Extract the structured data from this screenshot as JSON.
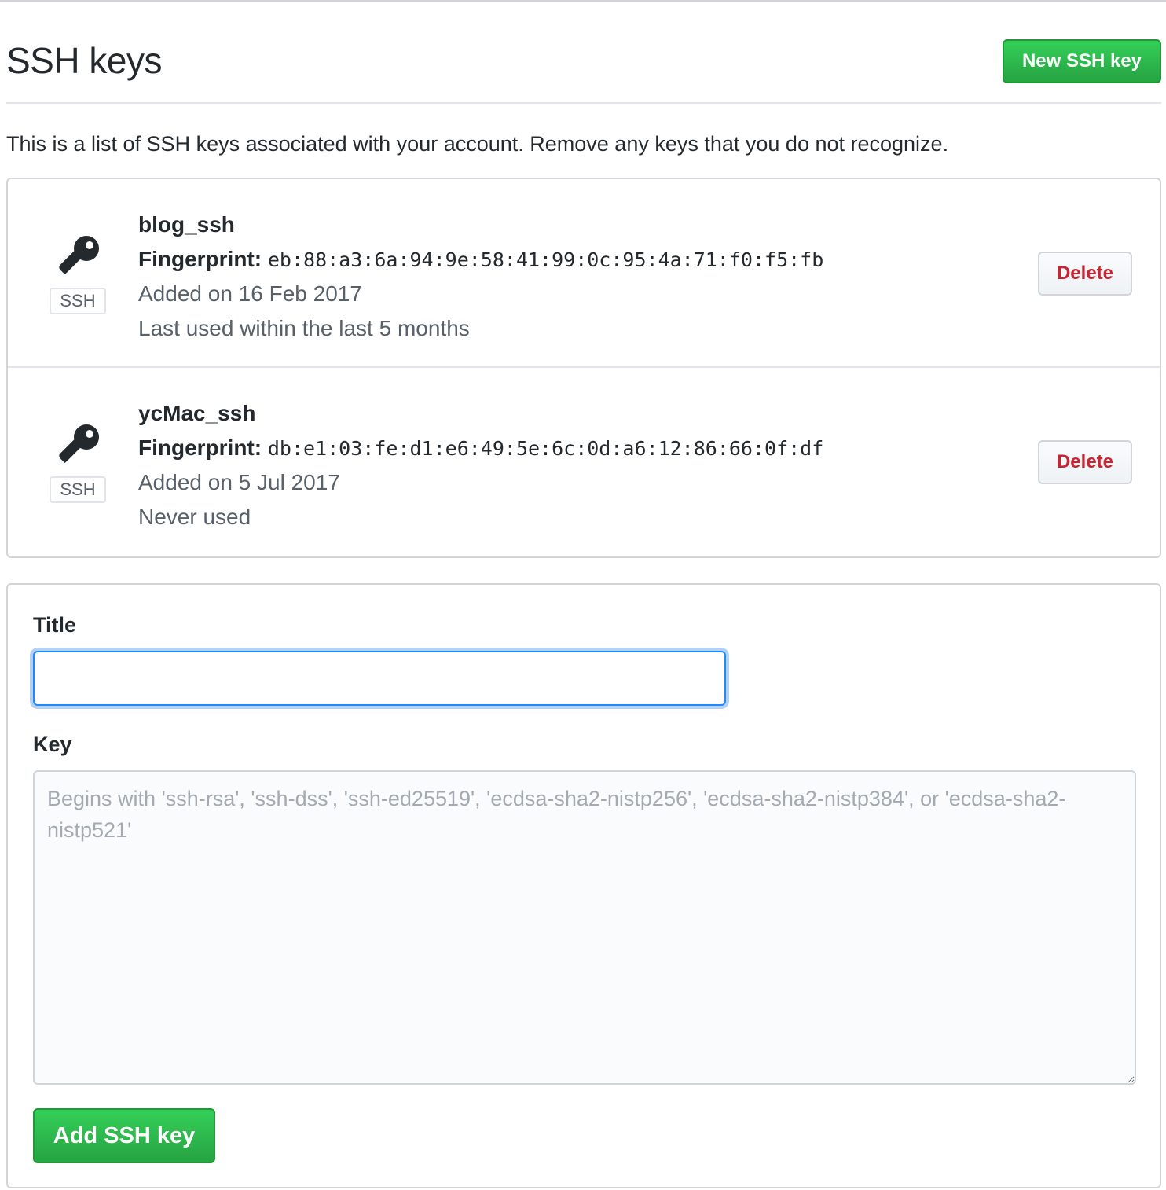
{
  "header": {
    "title": "SSH keys",
    "new_key_label": "New SSH key"
  },
  "intro": "This is a list of SSH keys associated with your account. Remove any keys that you do not recognize.",
  "keys": [
    {
      "name": "blog_ssh",
      "fingerprint_label": "Fingerprint:",
      "fingerprint": "eb:88:a3:6a:94:9e:58:41:99:0c:95:4a:71:f0:f5:fb",
      "added": "Added on 16 Feb 2017",
      "last_used": "Last used within the last 5 months",
      "type_label": "SSH",
      "delete_label": "Delete",
      "icon": "key-icon"
    },
    {
      "name": "ycMac_ssh",
      "fingerprint_label": "Fingerprint:",
      "fingerprint": "db:e1:03:fe:d1:e6:49:5e:6c:0d:a6:12:86:66:0f:df",
      "added": "Added on 5 Jul 2017",
      "last_used": "Never used",
      "type_label": "SSH",
      "delete_label": "Delete",
      "icon": "key-icon"
    }
  ],
  "form": {
    "title_label": "Title",
    "title_value": "",
    "key_label": "Key",
    "key_placeholder": "Begins with 'ssh-rsa', 'ssh-dss', 'ssh-ed25519', 'ecdsa-sha2-nistp256', 'ecdsa-sha2-nistp384', or 'ecdsa-sha2-nistp521'",
    "submit_label": "Add SSH key"
  },
  "colors": {
    "primary_green": "#28a745",
    "danger_red": "#cb2431",
    "focus_blue": "#2188ff",
    "muted_text": "#586069"
  }
}
